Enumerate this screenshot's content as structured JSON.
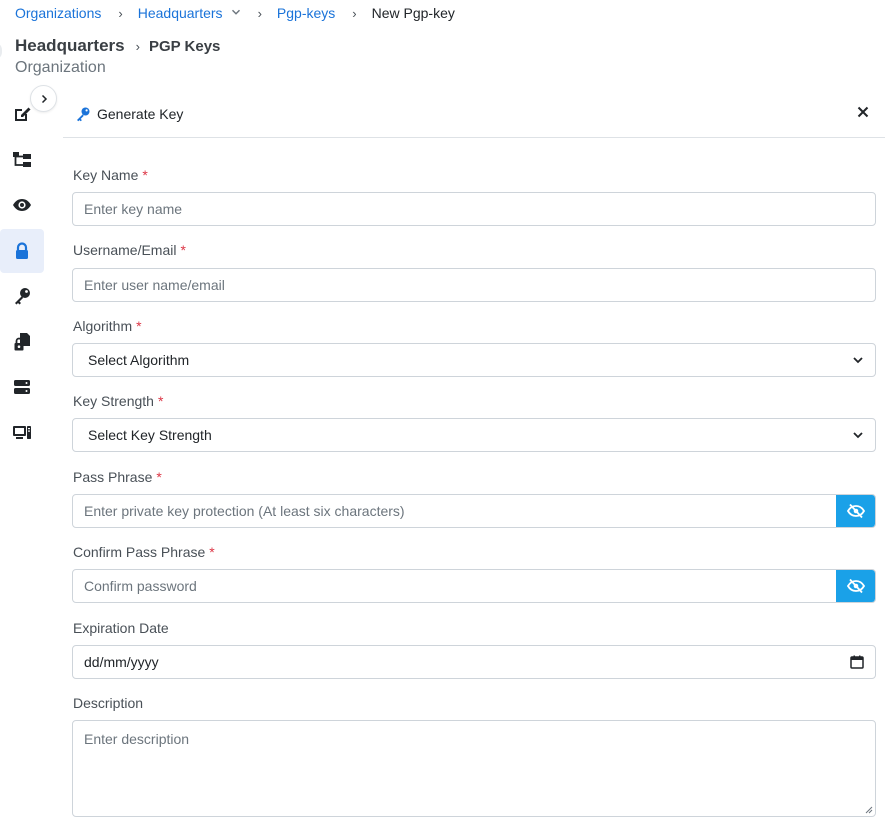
{
  "breadcrumb": {
    "items": [
      "Organizations",
      "Headquarters",
      "Pgp-keys"
    ],
    "current": "New Pgp-key"
  },
  "page": {
    "org_name": "Headquarters",
    "section": "PGP Keys",
    "subtitle": "Organization"
  },
  "sidebar": {
    "items": [
      "edit-icon",
      "hierarchy-icon",
      "eye-icon",
      "lock-icon",
      "key-icon",
      "file-lock-icon",
      "server-icon",
      "devices-icon"
    ],
    "active": "lock-icon"
  },
  "panel": {
    "title": "Generate Key"
  },
  "form": {
    "key_name": {
      "label": "Key Name",
      "placeholder": "Enter key name",
      "required": "*"
    },
    "username": {
      "label": "Username/Email",
      "placeholder": "Enter user name/email",
      "required": "*"
    },
    "algorithm": {
      "label": "Algorithm",
      "value": "Select Algorithm",
      "required": "*"
    },
    "key_strength": {
      "label": "Key Strength",
      "value": "Select Key Strength",
      "required": "*"
    },
    "pass_phrase": {
      "label": "Pass Phrase",
      "placeholder": "Enter private key protection (At least six characters)",
      "required": "*"
    },
    "confirm_pass": {
      "label": "Confirm Pass Phrase",
      "placeholder": "Confirm password",
      "required": "*"
    },
    "expiration": {
      "label": "Expiration Date",
      "value": "dd/mm/yyyy"
    },
    "description": {
      "label": "Description",
      "placeholder": "Enter description"
    }
  },
  "colors": {
    "link": "#1a73d9",
    "accent": "#1aa1e8",
    "required": "#dc3545",
    "active_bg": "#e8eefa"
  }
}
